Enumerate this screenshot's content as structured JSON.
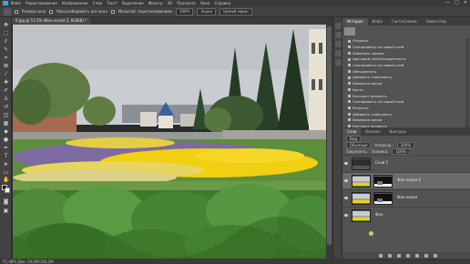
{
  "menu": [
    "Файл",
    "Редактирование",
    "Изображение",
    "Слои",
    "Текст",
    "Выделение",
    "Фильтр",
    "3D",
    "Просмотр",
    "Окно",
    "Справка"
  ],
  "window_controls": [
    "—",
    "□",
    "✕"
  ],
  "options": {
    "size_label": "Масштабировать все окна",
    "size_value": "Размер окна",
    "fit_label": "Масштаб. перетаскиванием",
    "zoom_value": "100%",
    "fit_screen": "Экран",
    "fill_screen": "Заполнить",
    "hand_label": "Целый экран"
  },
  "document_tab": "6.jpg @ 51,5% (Фон копия 2, RGB/8) *",
  "statusbar": "51,48%    Док: 20,6M/100,3M",
  "history": {
    "tabs": [
      "История",
      "Инфо",
      "Гистограмма",
      "Навигатор"
    ],
    "items": [
      "Открыть",
      "Скопировать на новый слой",
      "Заменить черное",
      "Цветовой тон/Насыщенность",
      "Скопировать на новый слой",
      "Обесцветить",
      "Добавить слой-маску",
      "Инверсия маски",
      "Кисть",
      "Контраст резкость",
      "Скопировать на новый слой",
      "Резкость",
      "Добавить слой-маску",
      "Инверсия маски",
      "Контраст резкость",
      "Кисть",
      "Отменить слой-маску",
      "Выделить всё",
      "Контроль яркость",
      "Копировать на новый слой",
      "Кривые",
      "Уровни"
    ],
    "active_index": 21
  },
  "layers": {
    "tabs": [
      "Слои",
      "Каналы",
      "Контуры"
    ],
    "kind_label": "Вид",
    "blend_mode": "Обычные",
    "opacity_label": "Непрозр.:",
    "opacity_value": "100%",
    "lock_label": "Закрепить:",
    "fill_label": "Заливка:",
    "fill_value": "100%",
    "items": [
      {
        "name": "Слой 1",
        "has_mask": false,
        "active": false
      },
      {
        "name": "Фон копия 2",
        "has_mask": true,
        "active": true
      },
      {
        "name": "Фон копия",
        "has_mask": true,
        "active": false
      },
      {
        "name": "Фон",
        "has_mask": false,
        "active": false
      }
    ]
  },
  "colors": {
    "accent": "#31a8ff",
    "panel": "#535353",
    "dark": "#3a3a3a",
    "active_row": "#6b6b6b",
    "flowers_yellow": "#f1cf12",
    "flowers_purple": "#7c6aa0",
    "leaves_green": "#4e8a3a"
  },
  "icons": [
    "move-icon",
    "marquee-icon",
    "lasso-icon",
    "crop-icon",
    "eyedropper-icon",
    "healing-icon",
    "brush-icon",
    "stamp-icon",
    "history-brush-icon",
    "eraser-icon",
    "gradient-icon",
    "blur-icon",
    "dodge-icon",
    "pen-icon",
    "type-icon",
    "path-select-icon",
    "shape-icon",
    "hand-icon",
    "zoom-icon"
  ]
}
